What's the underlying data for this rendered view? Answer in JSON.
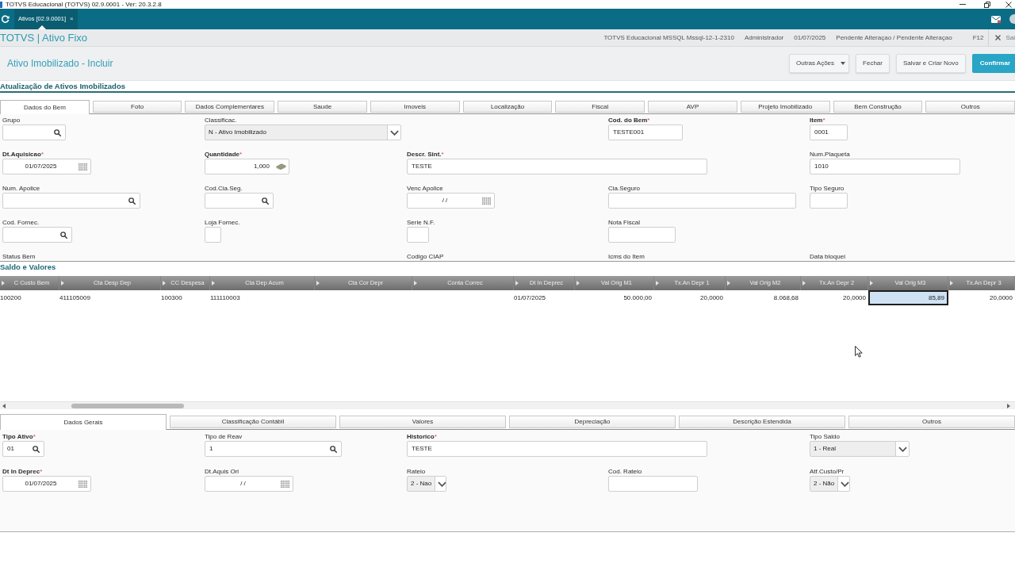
{
  "window": {
    "title": "TOTVS Educacional (TOTVS) 02.9.0001 - Ver: 20.3.2.8"
  },
  "app_bar": {
    "tabs": [
      {
        "label": "Ativos [02.9.0001]",
        "close": "×",
        "selected": true
      }
    ]
  },
  "header": {
    "title": "TOTVS | Ativo Fixo",
    "info": [
      "TOTVS Educacional MSSQL Mssql-12-1-2310",
      "Administrador",
      "01/07/2025",
      "Pendente Alteraçao / Pendente Alteraçao"
    ],
    "shortcut": "F12",
    "exit": "Sai"
  },
  "page": {
    "title": "Ativo Imobilizado - Incluir",
    "buttons": [
      {
        "label": "Outras Ações",
        "kind": "menu"
      },
      {
        "label": "Fechar",
        "kind": "default"
      },
      {
        "label": "Salvar e Criar Novo",
        "kind": "default"
      },
      {
        "label": "Confirmar",
        "kind": "primary"
      }
    ]
  },
  "form": {
    "title": "Atualização de Ativos Imobilizados",
    "tabs": [
      {
        "label": "Dados do Bem",
        "selected": true
      },
      {
        "label": "Foto",
        "selected": false
      },
      {
        "label": "Dados Complementares",
        "selected": false
      },
      {
        "label": "Saude",
        "selected": false
      },
      {
        "label": "Imoveis",
        "selected": false
      },
      {
        "label": "Localização",
        "selected": false
      },
      {
        "label": "Fiscal",
        "selected": false
      },
      {
        "label": "AVP",
        "selected": false
      },
      {
        "label": "Projeto Imobilizado",
        "selected": false
      },
      {
        "label": "Bem Construção",
        "selected": false
      },
      {
        "label": "Outros",
        "selected": false
      }
    ],
    "rows": [
      [
        {
          "label": "Grupo",
          "kind": "lookup"
        },
        {
          "label": "Classificac.",
          "kind": "select",
          "value": "N - Ativo Imobilizado"
        },
        null,
        {
          "label": "Cod. do Bem",
          "required_mark": "*",
          "kind": "text",
          "value": "TESTE001"
        },
        {
          "label": "Item",
          "required_mark": "*",
          "kind": "text",
          "value": "0001"
        }
      ],
      [
        {
          "label": "Dt.Aquisicao",
          "required_mark": "*",
          "kind": "date",
          "value": "01/07/2025"
        },
        {
          "label": "Quantidade",
          "required_mark": "*",
          "kind": "quantity",
          "value": "1,000"
        },
        {
          "label": "Descr. Sint.",
          "required_mark": "*",
          "kind": "text",
          "value": "TESTE"
        },
        null,
        {
          "label": "Num.Plaqueta",
          "kind": "text",
          "value": "1010"
        }
      ],
      [
        {
          "label": "Num. Apolice",
          "kind": "lookup"
        },
        {
          "label": "Cod.Cia.Seg.",
          "kind": "lookup"
        },
        {
          "label": "Venc Apolice",
          "kind": "date",
          "value": "/ /"
        },
        {
          "label": "Cia.Seguro",
          "kind": "text"
        },
        {
          "label": "Tipo Seguro",
          "kind": "text"
        }
      ],
      [
        {
          "label": "Cod. Fornec.",
          "kind": "lookup"
        },
        {
          "label": "Loja Fornec.",
          "kind": "text"
        },
        {
          "label": "Serie N.F.",
          "kind": "text"
        },
        {
          "label": "Nota Fiscal",
          "kind": "text"
        }
      ],
      [
        {
          "label": "Status Bem",
          "kind": "label"
        },
        null,
        {
          "label": "Codigo CIAP",
          "kind": "label"
        },
        {
          "label": "Icms do Item",
          "kind": "label"
        },
        {
          "label": "Data bloquei",
          "kind": "label"
        }
      ]
    ]
  },
  "grid": {
    "title": "Saldo e Valores",
    "columns": [
      {
        "label": "C Custo Bem",
        "kind": "text"
      },
      {
        "label": "Cta Desp Dep",
        "kind": "text"
      },
      {
        "label": "CC Despesa",
        "kind": "text"
      },
      {
        "label": "Cta Dep Acum",
        "kind": "text"
      },
      {
        "label": "Cta Cor Depr",
        "kind": "text"
      },
      {
        "label": "Conta Correc",
        "kind": "text"
      },
      {
        "label": "Dt In Deprec",
        "kind": "date"
      },
      {
        "label": "Val Orig M1",
        "kind": "number"
      },
      {
        "label": "Tx.An Depr 1",
        "kind": "number"
      },
      {
        "label": "Val Orig M2",
        "kind": "number"
      },
      {
        "label": "Tx.An Depr 2",
        "kind": "number"
      },
      {
        "label": "Val Orig M3",
        "kind": "number"
      },
      {
        "label": "Tx.An Depr 3",
        "kind": "number"
      }
    ],
    "rows": [
      {
        "cells": [
          {
            "value": "100200",
            "selected": false
          },
          {
            "value": "411105009",
            "selected": false
          },
          {
            "value": "100300",
            "selected": false
          },
          {
            "value": "111110003",
            "selected": false
          },
          {
            "selected": false
          },
          {
            "selected": false
          },
          {
            "value": "01/07/2025",
            "selected": false
          },
          {
            "value": "50.000,00",
            "selected": false
          },
          {
            "value": "20,0000",
            "selected": false
          },
          {
            "value": "8.068,68",
            "selected": false
          },
          {
            "value": "20,0000",
            "selected": false
          },
          {
            "value": "85,89",
            "selected": true
          },
          {
            "value": "20,0000",
            "selected": false
          }
        ]
      }
    ]
  },
  "detail": {
    "tabs": [
      {
        "label": "Dados Gerais",
        "selected": true
      },
      {
        "label": "Classificação Contábil",
        "selected": false
      },
      {
        "label": "Valores",
        "selected": false
      },
      {
        "label": "Depreciação",
        "selected": false
      },
      {
        "label": "Descrição Estendida",
        "selected": false
      },
      {
        "label": "Outros",
        "selected": false
      }
    ],
    "rows": [
      [
        {
          "label": "Tipo Ativo",
          "required_mark": "*",
          "kind": "lookup",
          "value": "01"
        },
        {
          "label": "Tipo de Reav",
          "kind": "lookup",
          "value": "1"
        },
        {
          "label": "Historico",
          "required_mark": "*",
          "kind": "text",
          "value": "TESTE"
        },
        null,
        {
          "label": "Tipo Saldo",
          "kind": "select",
          "value": "1 - Real"
        }
      ],
      [
        {
          "label": "Dt In Deprec",
          "required_mark": "*",
          "kind": "date",
          "value": "01/07/2025"
        },
        {
          "label": "Dt.Aquis Ori",
          "kind": "date",
          "value": "/ /"
        },
        {
          "label": "Rateio",
          "kind": "select",
          "value": "2 - Nao"
        },
        {
          "label": "Cod. Rateio",
          "kind": "text"
        },
        {
          "label": "Atf.Custo/Pr",
          "kind": "select",
          "value": "2 - Não"
        }
      ]
    ]
  }
}
